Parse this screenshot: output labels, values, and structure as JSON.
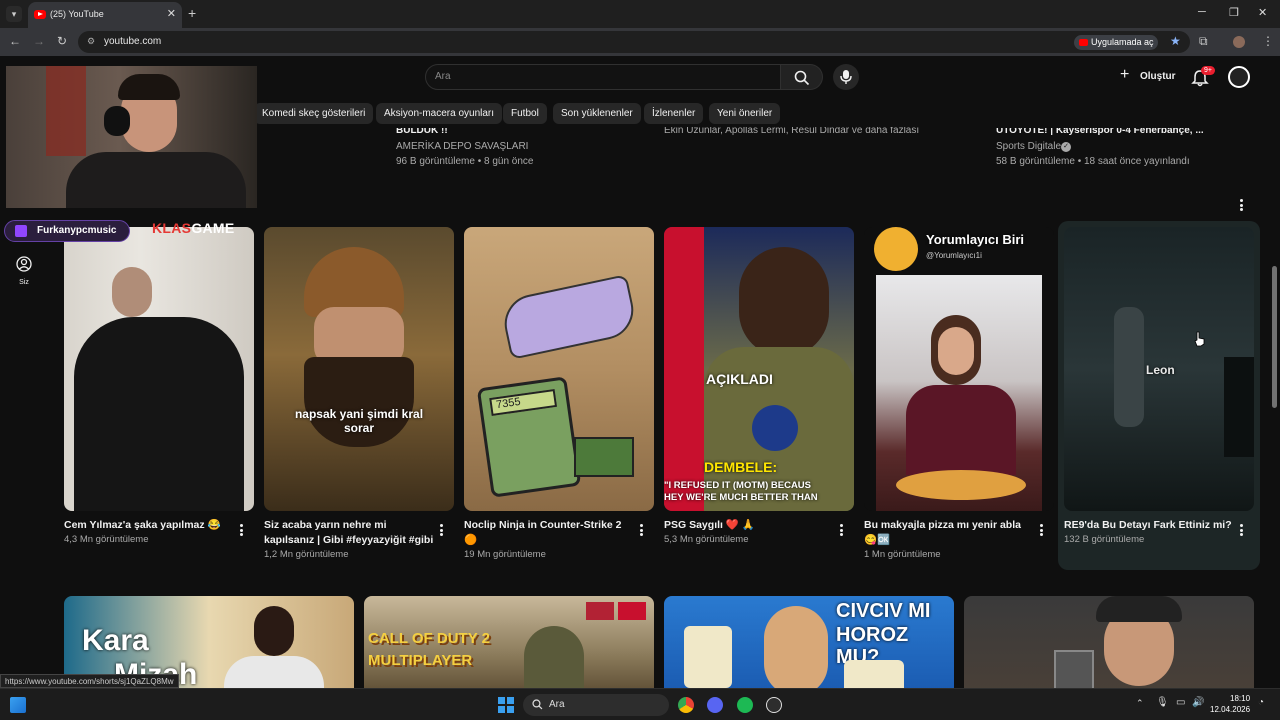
{
  "browser": {
    "tab_title": "(25) YouTube",
    "url": "youtube.com",
    "open_in_app": "Uygulamada aç"
  },
  "youtube": {
    "search_placeholder": "Ara",
    "create_label": "Oluştur",
    "notification_count": "9+",
    "chips": [
      "Komedi skeç gösterileri",
      "Aksiyon-macera oyunları",
      "Futbol",
      "Son yüklenenler",
      "İzlenenler",
      "Yeni öneriler"
    ],
    "sidebar_you_label": "Siz",
    "top_row": [
      {
        "title": "BULDUK !!",
        "channel": "AMERİKA DEPO SAVAŞLARI",
        "meta": "96 B görüntüleme • 8 gün önce"
      },
      {
        "title": "",
        "channel": "Ekin Uzunlar, Apollas Lermi, Resul Dindar ve daha fazlası",
        "meta": ""
      },
      {
        "title": "UTOYOTE! | Kayserispor 0-4 Fenerbahçe, ...",
        "channel": "Sports Digitale",
        "meta": "58 B görüntüleme • 18 saat önce yayınlandı"
      }
    ],
    "shorts": [
      {
        "title_lines": [
          "Cem Yılmaz'a şaka yapılmaz 😂"
        ],
        "views": "4,3 Mn görüntüleme",
        "overlay": ""
      },
      {
        "title_lines": [
          "Siz acaba yarın nehre mi",
          "kapılsanız | Gibi #feyyazyiğit #gibi"
        ],
        "views": "1,2 Mn görüntüleme",
        "overlay": "napsak yani şimdi kral sorar"
      },
      {
        "title_lines": [
          "Noclip Ninja in Counter-Strike 2",
          "🟠"
        ],
        "views": "19 Mn görüntüleme",
        "overlay": "7355"
      },
      {
        "title_lines": [
          "PSG Saygılı ❤️ 🙏"
        ],
        "views": "5,3 Mn görüntüleme",
        "overlay": "AÇIKLADI",
        "overlay2": "DEMBELE:",
        "overlay3": "\"I REFUSED IT (MOTM) BECAUS",
        "overlay4": "HEY WE'RE MUCH BETTER THAN"
      },
      {
        "title_lines": [
          "Bu makyajla pizza mı yenir abla",
          "😋🆗"
        ],
        "views": "1 Mn görüntüleme",
        "overlay": "Yorumlayıcı Biri",
        "overlay2": "@Yorumlayıcı1i"
      },
      {
        "title_lines": [
          "RE9'da Bu Detayı Fark Ettiniz mi?"
        ],
        "views": "132 B görüntüleme",
        "overlay": "Leon"
      }
    ],
    "bottom_row": [
      {
        "overlay": "Kara",
        "overlay2": "Mizah"
      },
      {
        "overlay": "CALL OF DUTY 2",
        "overlay2": "MULTIPLAYER"
      },
      {
        "overlay": "CIVCIV MI",
        "overlay2": "HOROZ MU?"
      },
      {
        "overlay": ""
      }
    ]
  },
  "overlay": {
    "streamer_name": "Furkanypcmusic",
    "logo_text_1": "KLAS",
    "logo_text_2": "GAME"
  },
  "status_url": "https://www.youtube.com/shorts/sj1QaZLQ8Mw",
  "taskbar": {
    "search": "Ara",
    "time": "18:10",
    "date": "12.04.2026"
  },
  "colors": {
    "accent": "#ff0000",
    "twitch": "#9146ff",
    "logo_red": "#e53935"
  }
}
